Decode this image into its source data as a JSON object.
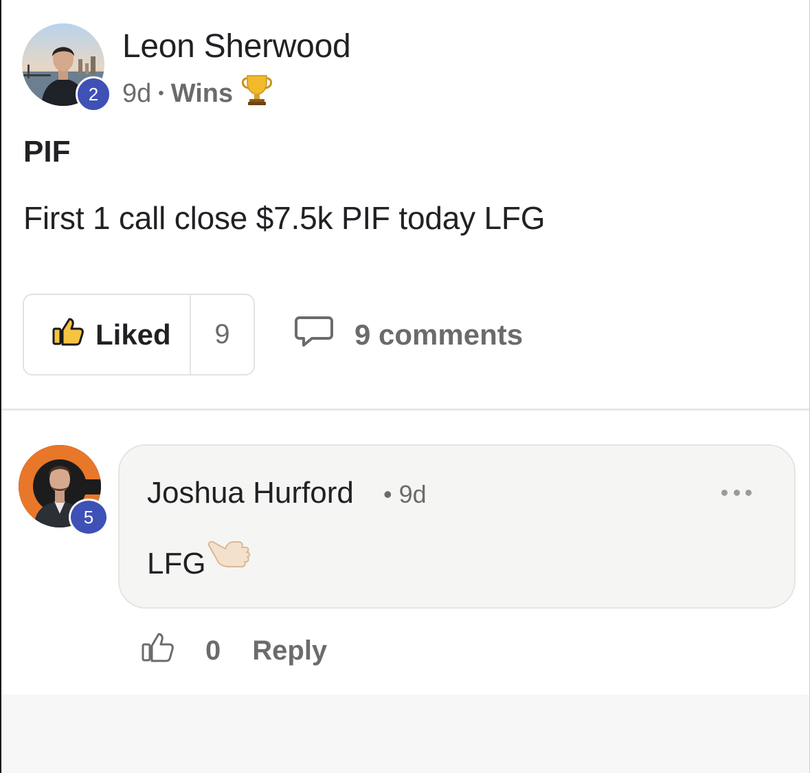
{
  "post": {
    "author": "Leon Sherwood",
    "author_level": "2",
    "age": "9d",
    "separator": "•",
    "category": "Wins",
    "category_icon": "trophy-icon",
    "title": "PIF",
    "body": "First 1 call close $7.5k PIF today LFG",
    "like_label": "Liked",
    "like_count": "9",
    "comments_label": "9 comments"
  },
  "comment": {
    "author": "Joshua Hurford",
    "author_level": "5",
    "meta": "• 9d",
    "text": "LFG",
    "text_emoji": "call-me-hand-icon",
    "like_count": "0",
    "reply_label": "Reply"
  },
  "colors": {
    "badge": "#3f51b5",
    "text": "#202124",
    "muted": "#6b6b6b",
    "bubble": "#f5f5f4"
  }
}
